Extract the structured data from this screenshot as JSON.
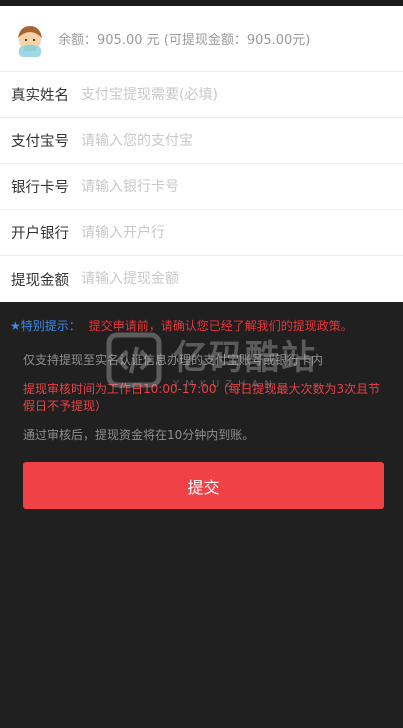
{
  "balance": {
    "text": "余额：905.00 元 (可提现金额：905.00元)"
  },
  "form": {
    "fields": [
      {
        "label": "真实姓名",
        "placeholder": "支付宝提现需要(必填)"
      },
      {
        "label": "支付宝号",
        "placeholder": "请输入您的支付宝"
      },
      {
        "label": "银行卡号",
        "placeholder": "请输入银行卡号"
      },
      {
        "label": "开户银行",
        "placeholder": "请输入开户行"
      },
      {
        "label": "提现金额",
        "placeholder": "请输入提现金额"
      }
    ]
  },
  "notice": {
    "label": "★特别提示：",
    "text": "提交申请前，请确认您已经了解我们的提现政策。"
  },
  "info": {
    "rule1": "仅支持提现至实名认证信息办理的支付宝账号或银行卡内",
    "rule2": "提现审核时间为工作日10:00-17:00（每日提现最大次数为3次且节假日不予提现）",
    "rule3": "通过审核后，提现资金将在10分钟内到账。"
  },
  "submit": {
    "label": "提交"
  },
  "watermark": {
    "title": "亿码酷站",
    "subtitle": "YMKUZHAN"
  },
  "colors": {
    "accent": "#f04246",
    "notice_blue": "#3a8be8",
    "warning_red": "#e8343a",
    "background_dark": "#202020"
  }
}
